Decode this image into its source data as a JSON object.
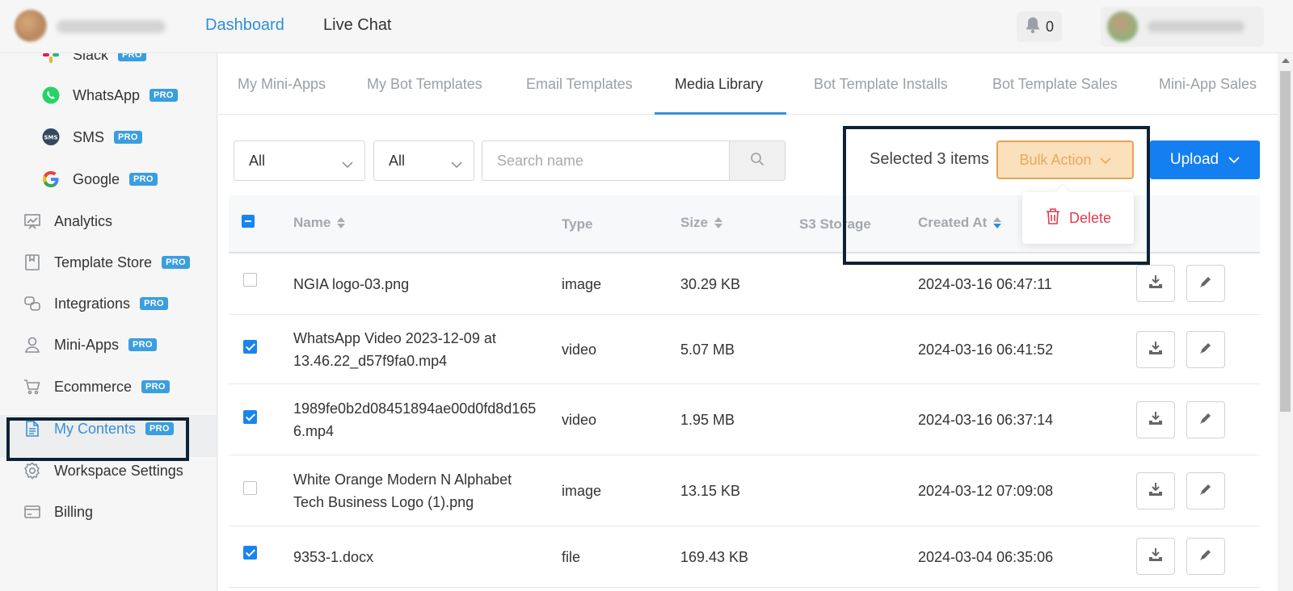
{
  "topbar": {
    "nav": [
      "Dashboard",
      "Live Chat"
    ],
    "notification_count": "0"
  },
  "sidebar": {
    "pro_label": "PRO",
    "items": [
      {
        "label": "Slack",
        "icon": "slack-icon",
        "pro": true
      },
      {
        "label": "WhatsApp",
        "icon": "whatsapp-icon",
        "pro": true
      },
      {
        "label": "SMS",
        "icon": "sms-icon",
        "pro": true
      },
      {
        "label": "Google",
        "icon": "google-icon",
        "pro": true
      },
      {
        "label": "Analytics",
        "icon": "analytics-icon",
        "pro": false
      },
      {
        "label": "Template Store",
        "icon": "template-store-icon",
        "pro": true
      },
      {
        "label": "Integrations",
        "icon": "integrations-icon",
        "pro": true
      },
      {
        "label": "Mini-Apps",
        "icon": "mini-apps-icon",
        "pro": true
      },
      {
        "label": "Ecommerce",
        "icon": "cart-icon",
        "pro": true
      },
      {
        "label": "My Contents",
        "icon": "document-icon",
        "pro": true,
        "active": true
      },
      {
        "label": "Workspace Settings",
        "icon": "gear-icon",
        "pro": false
      },
      {
        "label": "Billing",
        "icon": "credit-card-icon",
        "pro": false
      }
    ]
  },
  "tabs": [
    "My Mini-Apps",
    "My Bot Templates",
    "Email Templates",
    "Media Library",
    "Bot Template Installs",
    "Bot Template Sales",
    "Mini-App Sales"
  ],
  "active_tab": "Media Library",
  "filters": {
    "type_value": "All",
    "storage_value": "All",
    "search_placeholder": "Search name"
  },
  "bulk": {
    "selected_text": "Selected 3 items",
    "bulk_action_label": "Bulk Action",
    "delete_label": "Delete",
    "upload_label": "Upload"
  },
  "table": {
    "columns": {
      "name": "Name",
      "type": "Type",
      "size": "Size",
      "storage": "S3 Storage",
      "created": "Created At"
    },
    "rows": [
      {
        "checked": false,
        "name": "NGIA logo-03.png",
        "type": "image",
        "size": "30.29 KB",
        "storage": "",
        "created": "2024-03-16 06:47:11"
      },
      {
        "checked": true,
        "name": "WhatsApp Video 2023-12-09 at 13.46.22_d57f9fa0.mp4",
        "type": "video",
        "size": "5.07 MB",
        "storage": "",
        "created": "2024-03-16 06:41:52"
      },
      {
        "checked": true,
        "name": "1989fe0b2d08451894ae00d0fd8d1656.mp4",
        "type": "video",
        "size": "1.95 MB",
        "storage": "",
        "created": "2024-03-16 06:37:14"
      },
      {
        "checked": false,
        "name": "White Orange Modern N Alphabet Tech Business Logo (1).png",
        "type": "image",
        "size": "13.15 KB",
        "storage": "",
        "created": "2024-03-12 07:09:08"
      },
      {
        "checked": true,
        "name": "9353-1.docx",
        "type": "file",
        "size": "169.43 KB",
        "storage": "",
        "created": "2024-03-04 06:35:06"
      }
    ]
  },
  "colors": {
    "accent": "#2e8fd6",
    "upload": "#137ff0",
    "bulk_bg": "#fbe0bc",
    "delete": "#e23b4c",
    "highlight_border": "#0d2235"
  }
}
